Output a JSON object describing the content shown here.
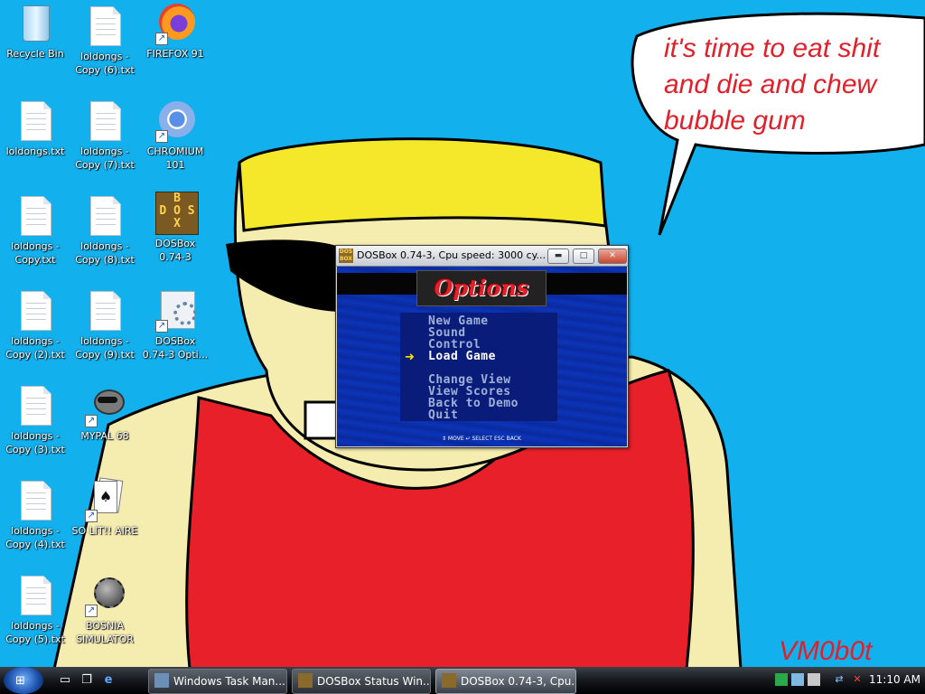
{
  "wallpaper": {
    "speech_bubble": "it's time to eat shit and die and chew bubble gum",
    "speech_lines": [
      "it's time to eat shit",
      "and die and chew",
      "bubble gum"
    ],
    "signature": "VM0b0t",
    "colors": {
      "sky": "#13b0ee",
      "hat": "#f5e82a",
      "skin": "#f5ecb0",
      "shirt": "#e8202a",
      "text_red": "#e0202a"
    }
  },
  "desktop_icons": [
    {
      "label": "Recycle Bin",
      "icon": "recycle-bin-icon"
    },
    {
      "label": "loldongs - Copy (6).txt",
      "icon": "text-file-icon"
    },
    {
      "label": "FIREFOX 91",
      "icon": "firefox-icon"
    },
    {
      "label": "loldongs.txt",
      "icon": "text-file-icon"
    },
    {
      "label": "loldongs - Copy (7).txt",
      "icon": "text-file-icon"
    },
    {
      "label": "CHROMIUM 101",
      "icon": "chromium-icon"
    },
    {
      "label": "loldongs - Copy.txt",
      "icon": "text-file-icon"
    },
    {
      "label": "loldongs - Copy (8).txt",
      "icon": "text-file-icon"
    },
    {
      "label": "DOSBox 0.74-3",
      "icon": "dosbox-icon"
    },
    {
      "label": "loldongs - Copy (2).txt",
      "icon": "text-file-icon"
    },
    {
      "label": "loldongs - Copy (9).txt",
      "icon": "text-file-icon"
    },
    {
      "label": "DOSBox 0.74-3 Opti...",
      "icon": "dosbox-options-icon"
    },
    {
      "label": "loldongs - Copy (3).txt",
      "icon": "text-file-icon"
    },
    {
      "label": "MYPAL 68",
      "icon": "mypal-raccoon-icon"
    },
    {
      "label": "loldongs - Copy (4).txt",
      "icon": "text-file-icon"
    },
    {
      "label": "SO LIT!! AIRE",
      "icon": "solitaire-cards-icon"
    },
    {
      "label": "loldongs - Copy (5).txt",
      "icon": "text-file-icon"
    },
    {
      "label": "BOSNIA SIMULATOR",
      "icon": "minesweeper-mine-icon"
    }
  ],
  "dosbox_window": {
    "title": "DOSBox 0.74-3, Cpu speed:   3000 cy...",
    "icon_text": "DOS BOX",
    "buttons": {
      "minimize": "▬",
      "maximize": "□",
      "close": "✕"
    },
    "game": {
      "heading": "Options",
      "menu_items": [
        "New Game",
        "Sound",
        "Control",
        "Load Game",
        "Change View",
        "View Scores",
        "Back to Demo",
        "Quit"
      ],
      "selected_item": "Load Game",
      "selector_glyph": "➜",
      "hint": "⇕ MOVE ↵ SELECT ESC BACK"
    }
  },
  "taskbar": {
    "start_glyph": "⊞",
    "quick_launch": [
      {
        "name": "show-desktop-icon",
        "glyph": "▭"
      },
      {
        "name": "switch-windows-icon",
        "glyph": "❐"
      },
      {
        "name": "internet-explorer-icon",
        "glyph": "e"
      }
    ],
    "tasks": [
      {
        "label": "Windows Task Man...",
        "active": false
      },
      {
        "label": "DOSBox Status Win...",
        "active": false
      },
      {
        "label": "DOSBox 0.74-3, Cpu...",
        "active": true
      }
    ],
    "tray_icons": [
      "network-icon",
      "volume-muted-icon"
    ],
    "clock": "11:10 AM"
  }
}
